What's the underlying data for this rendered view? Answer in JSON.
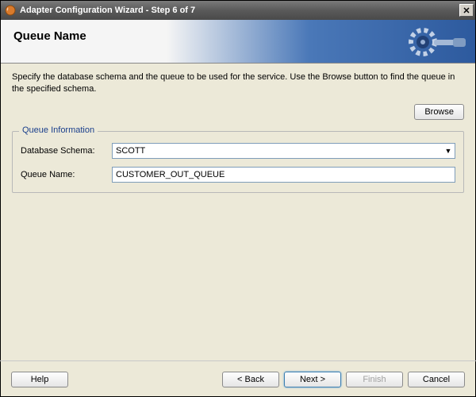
{
  "window": {
    "title": "Adapter Configuration Wizard - Step 6 of 7"
  },
  "header": {
    "title": "Queue Name"
  },
  "instruction": "Specify the database schema and the queue to be used for the service. Use the Browse button to find the queue in the specified schema.",
  "browse_button_label": "Browse",
  "fieldset": {
    "legend": "Queue Information",
    "schema_label": "Database Schema:",
    "schema_value": "SCOTT",
    "queue_label": "Queue Name:",
    "queue_value": "CUSTOMER_OUT_QUEUE"
  },
  "buttons": {
    "help": "Help",
    "back": "< Back",
    "next": "Next >",
    "finish": "Finish",
    "cancel": "Cancel"
  }
}
